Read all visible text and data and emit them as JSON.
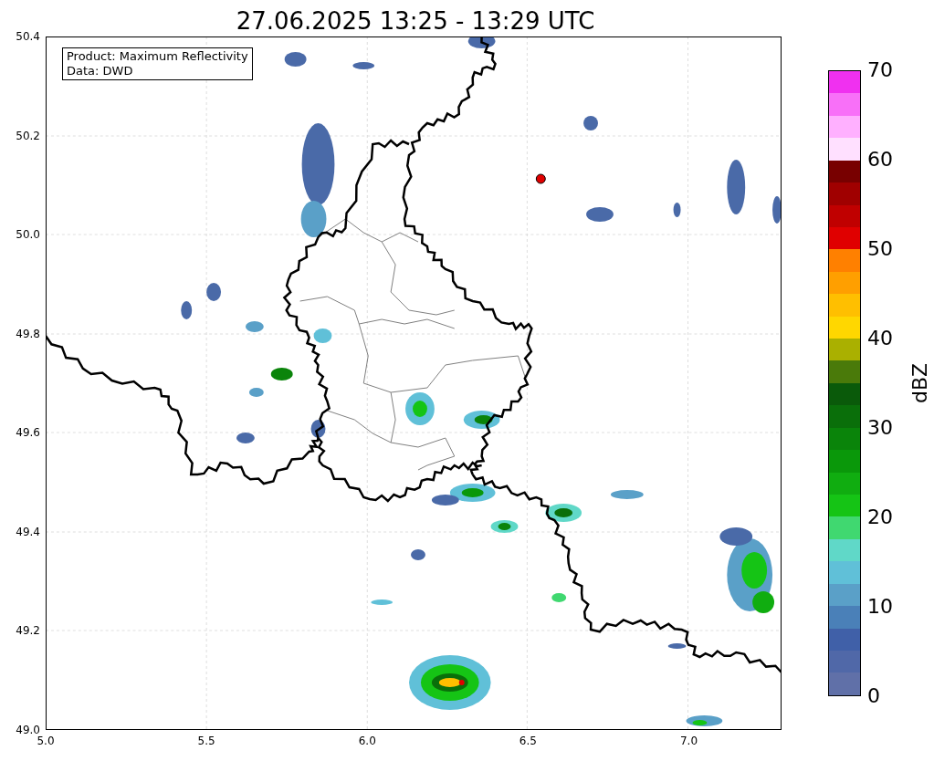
{
  "title": "27.06.2025 13:25 - 13:29 UTC",
  "map": {
    "yticks": [
      "50.4",
      "50.2",
      "50.0",
      "49.8",
      "49.6",
      "49.4",
      "49.2",
      "49.0"
    ],
    "xticks": [
      "5.0",
      "5.5",
      "6.0",
      "6.5",
      "7.0"
    ],
    "info_box": [
      "Product: Maximum Reflectivity",
      "Data: DWD"
    ]
  },
  "colorbar": {
    "label": "dBZ",
    "ticks": [
      "70",
      "60",
      "50",
      "40",
      "30",
      "20",
      "10",
      "0"
    ],
    "segments": [
      {
        "color": "#f030f0"
      },
      {
        "color": "#f870f8"
      },
      {
        "color": "#ffb0ff"
      },
      {
        "color": "#ffe0ff"
      },
      {
        "color": "#780000"
      },
      {
        "color": "#a00000"
      },
      {
        "color": "#c00000"
      },
      {
        "color": "#e00000"
      },
      {
        "color": "#ff8000"
      },
      {
        "color": "#ff9f00"
      },
      {
        "color": "#ffbf00"
      },
      {
        "color": "#ffd700"
      },
      {
        "color": "#aab000"
      },
      {
        "color": "#4a7a0a"
      },
      {
        "color": "#0a5a0a"
      },
      {
        "color": "#0a6f0a"
      },
      {
        "color": "#0a840a"
      },
      {
        "color": "#0a980a"
      },
      {
        "color": "#10ad10"
      },
      {
        "color": "#15c415"
      },
      {
        "color": "#40d870"
      },
      {
        "color": "#60d8c8"
      },
      {
        "color": "#60c0d8"
      },
      {
        "color": "#5aa0c8"
      },
      {
        "color": "#4a80b8"
      },
      {
        "color": "#4060a8"
      },
      {
        "color": "#5068a8"
      },
      {
        "color": "#6070a8"
      }
    ]
  }
}
